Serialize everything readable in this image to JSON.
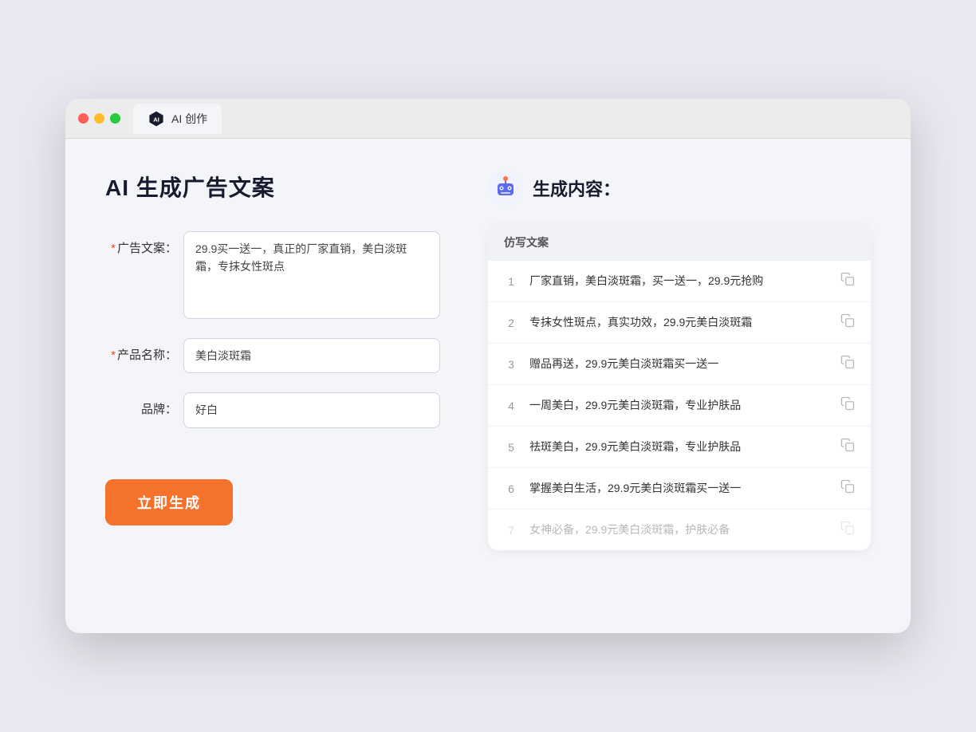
{
  "browser": {
    "tab_label": "AI 创作",
    "traffic_lights": [
      "red",
      "yellow",
      "green"
    ]
  },
  "left_panel": {
    "title": "AI 生成广告文案",
    "fields": [
      {
        "id": "ad_copy",
        "label": "广告文案：",
        "required": true,
        "type": "textarea",
        "value": "29.9买一送一，真正的厂家直销，美白淡斑霜，专抹女性斑点"
      },
      {
        "id": "product_name",
        "label": "产品名称：",
        "required": true,
        "type": "input",
        "value": "美白淡斑霜"
      },
      {
        "id": "brand",
        "label": "品牌：",
        "required": false,
        "type": "input",
        "value": "好白"
      }
    ],
    "button_label": "立即生成"
  },
  "right_panel": {
    "title": "生成内容：",
    "table_header": "仿写文案",
    "results": [
      {
        "num": "1",
        "text": "厂家直销，美白淡斑霜，买一送一，29.9元抢购",
        "faded": false
      },
      {
        "num": "2",
        "text": "专抹女性斑点，真实功效，29.9元美白淡斑霜",
        "faded": false
      },
      {
        "num": "3",
        "text": "赠品再送，29.9元美白淡斑霜买一送一",
        "faded": false
      },
      {
        "num": "4",
        "text": "一周美白，29.9元美白淡斑霜，专业护肤品",
        "faded": false
      },
      {
        "num": "5",
        "text": "祛斑美白，29.9元美白淡斑霜，专业护肤品",
        "faded": false
      },
      {
        "num": "6",
        "text": "掌握美白生活，29.9元美白淡斑霜买一送一",
        "faded": false
      },
      {
        "num": "7",
        "text": "女神必备，29.9元美白淡斑霜，护肤必备",
        "faded": true
      }
    ]
  },
  "colors": {
    "accent_orange": "#f4722b",
    "accent_blue": "#6b7ff0",
    "required_red": "#e64a19"
  }
}
